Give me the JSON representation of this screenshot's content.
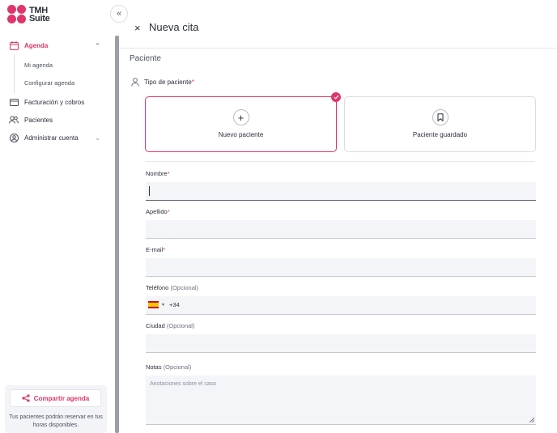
{
  "brand": {
    "line1": "TMH",
    "line2": "Suite",
    "accent": "#e0356a"
  },
  "sidebar": {
    "collapse_icon": "«",
    "agenda": {
      "label": "Agenda",
      "icon": "calendar-icon"
    },
    "sub_items": [
      "Mi agenda",
      "Configurar agenda"
    ],
    "items": [
      {
        "label": "Facturación y cobros",
        "icon": "billing-icon"
      },
      {
        "label": "Pacientes",
        "icon": "patients-icon"
      },
      {
        "label": "Administrar cuenta",
        "icon": "account-icon"
      }
    ],
    "share": {
      "button": "Compartir agenda",
      "text": "Tus pacientes podrán reservar en tus horas disponibles."
    }
  },
  "header": {
    "close": "×",
    "title": "Nueva cita"
  },
  "form": {
    "section": "Paciente",
    "tipo_label": "Tipo de paciente",
    "required_mark": "*",
    "choices": [
      {
        "label": "Nuevo paciente",
        "icon": "plus-icon",
        "selected": true
      },
      {
        "label": "Paciente guardado",
        "icon": "bookmark-icon",
        "selected": false
      }
    ],
    "nombre": "Nombre",
    "apellido": "Apellido",
    "email": "E-mail",
    "telefono": "Teléfono",
    "telefono_opt": "(Opcional)",
    "phone_prefix": "+34",
    "ciudad": "Ciudad",
    "ciudad_opt": "(Opcional)",
    "notas": "Notas",
    "notas_opt": "(Opcional)",
    "notas_placeholder": "Anotaciones sobre el caso"
  }
}
